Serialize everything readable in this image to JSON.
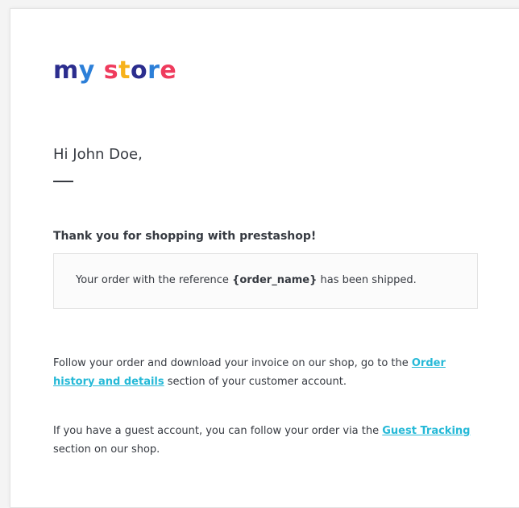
{
  "logo": {
    "letters": [
      {
        "char": "m",
        "color": "#2b2d8e"
      },
      {
        "char": "y",
        "color": "#2c7fd8"
      },
      {
        "char": " ",
        "color": "#ffffff"
      },
      {
        "char": "s",
        "color": "#ef3b5d"
      },
      {
        "char": "t",
        "color": "#f7b21b"
      },
      {
        "char": "o",
        "color": "#2b2d8e"
      },
      {
        "char": "r",
        "color": "#2c7fd8"
      },
      {
        "char": "e",
        "color": "#ef3b5d"
      }
    ],
    "text": "my store"
  },
  "greeting": "Hi John Doe,",
  "thanks": "Thank you for shopping with prestashop!",
  "notice": {
    "prefix": "Your order with the reference ",
    "reference": "{order_name}",
    "suffix": " has been shipped."
  },
  "paragraph1": {
    "prefix": "Follow your order and download your invoice on our shop, go to the ",
    "link": "Order history and details",
    "suffix": " section of your customer account."
  },
  "paragraph2": {
    "prefix": "If you have a guest account, you can follow your order via the ",
    "link": "Guest Tracking",
    "suffix": " section on our shop."
  },
  "colors": {
    "text": "#363a41",
    "link": "#25b9d7",
    "box_bg": "#fbfbfb",
    "border": "#e3e3e3"
  }
}
